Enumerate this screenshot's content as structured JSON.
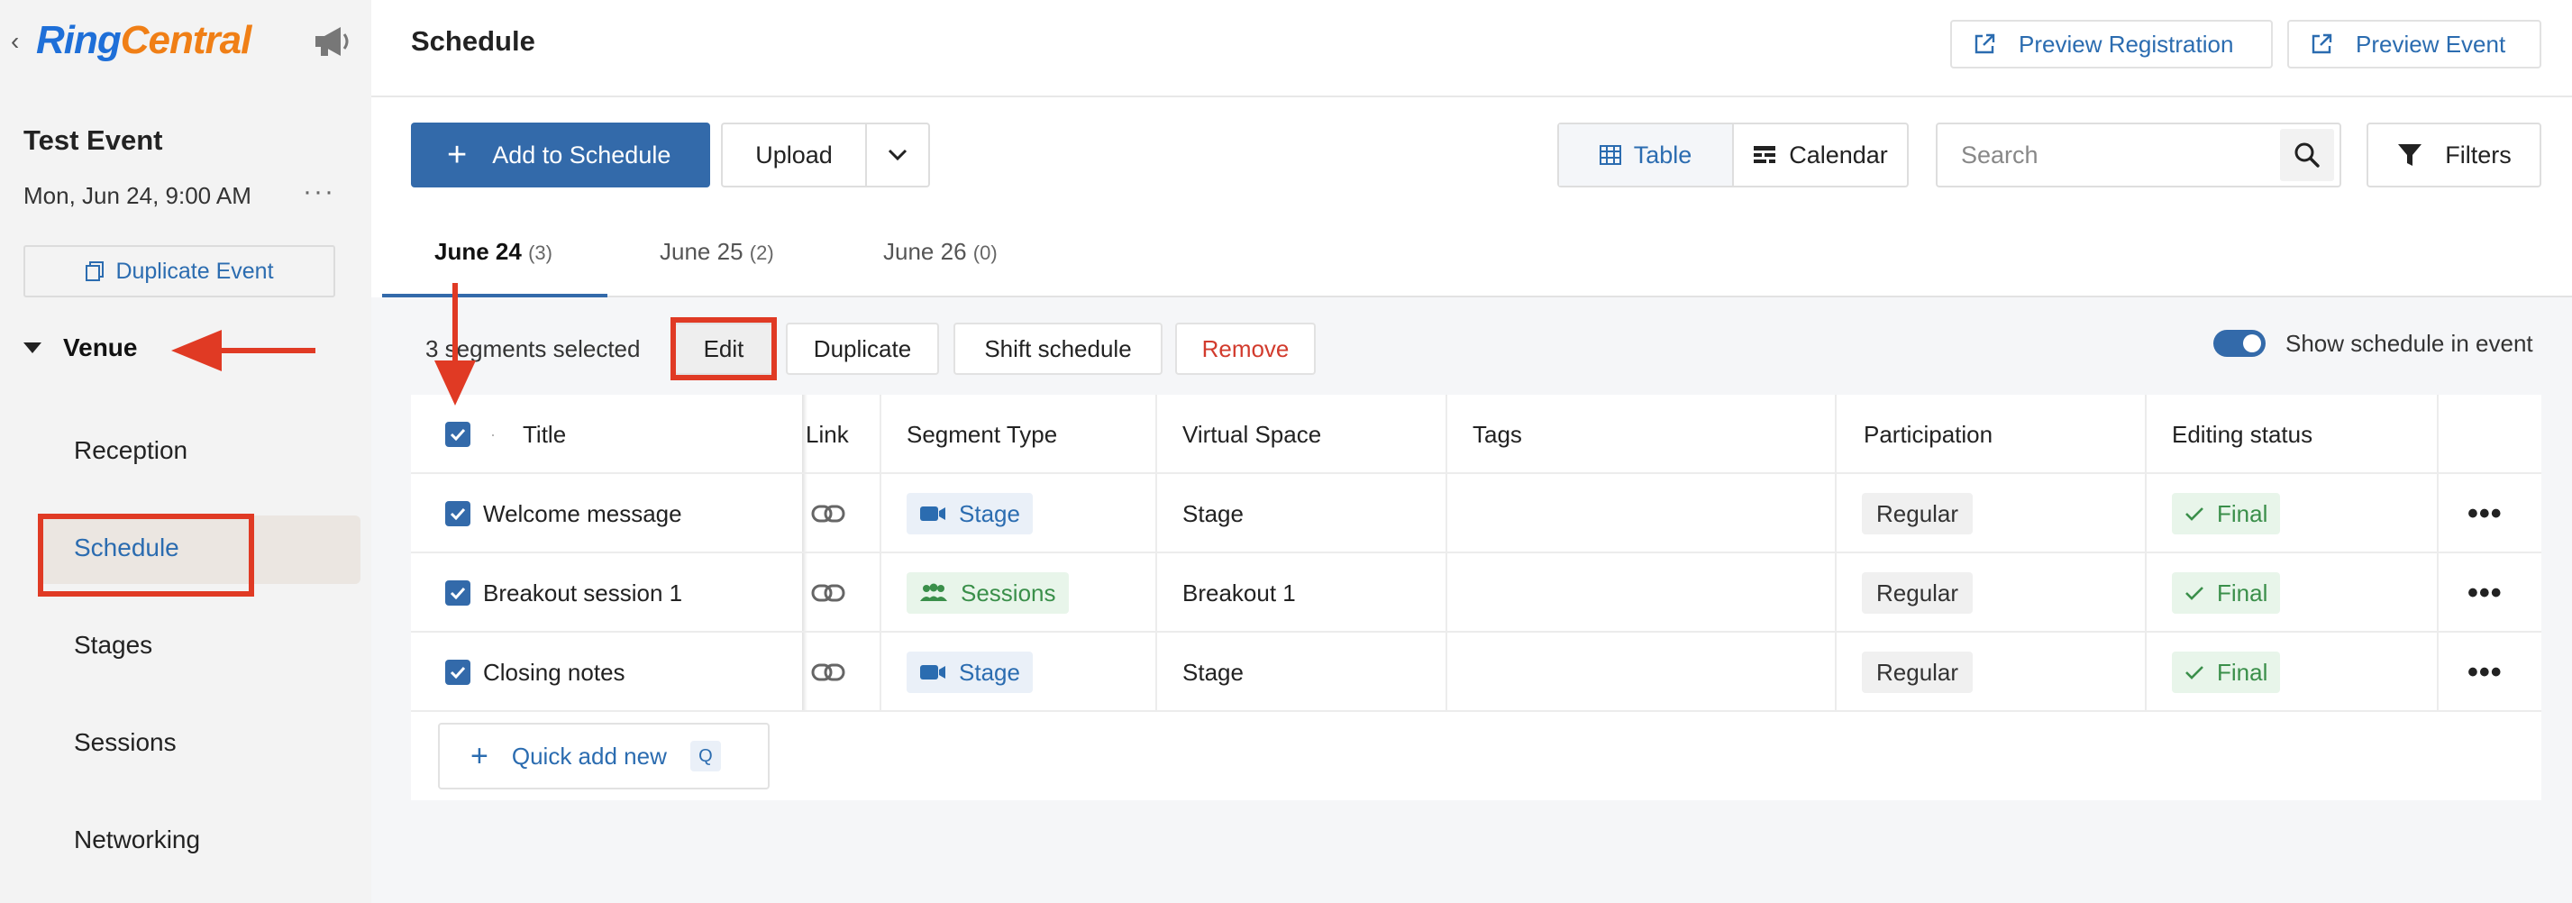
{
  "sidebar": {
    "logo_ring": "Ring",
    "logo_central": "Central",
    "event_title": "Test Event",
    "event_date": "Mon, Jun 24, 9:00 AM",
    "more": "···",
    "duplicate_event": "Duplicate Event",
    "venue_label": "Venue",
    "items": [
      {
        "label": "Reception"
      },
      {
        "label": "Schedule"
      },
      {
        "label": "Stages"
      },
      {
        "label": "Sessions"
      },
      {
        "label": "Networking"
      }
    ],
    "active_item": "Schedule"
  },
  "header": {
    "title": "Schedule",
    "preview_registration": "Preview Registration",
    "preview_event": "Preview Event"
  },
  "toolbar": {
    "add_to_schedule": "Add to Schedule",
    "upload": "Upload",
    "view_table": "Table",
    "view_calendar": "Calendar",
    "active_view": "Table",
    "search_placeholder": "Search",
    "filters": "Filters"
  },
  "tabs": [
    {
      "label": "June 24",
      "count": "(3)",
      "active": true
    },
    {
      "label": "June 25",
      "count": "(2)",
      "active": false
    },
    {
      "label": "June 26",
      "count": "(0)",
      "active": false
    }
  ],
  "selection": {
    "text": "3 segments selected",
    "edit": "Edit",
    "duplicate": "Duplicate",
    "shift": "Shift schedule",
    "remove": "Remove"
  },
  "show_schedule": {
    "label": "Show schedule in event",
    "enabled": true
  },
  "table": {
    "headers": {
      "dot": "·",
      "title": "Title",
      "link": "Link",
      "segment_type": "Segment Type",
      "virtual_space": "Virtual Space",
      "tags": "Tags",
      "participation": "Participation",
      "editing_status": "Editing status"
    },
    "rows": [
      {
        "title": "Welcome message",
        "segment_type": "Stage",
        "segment_icon": "video-camera-icon",
        "virtual_space": "Stage",
        "tags": "",
        "participation": "Regular",
        "status": "Final"
      },
      {
        "title": "Breakout session 1",
        "segment_type": "Sessions",
        "segment_icon": "people-group-icon",
        "virtual_space": "Breakout 1",
        "tags": "",
        "participation": "Regular",
        "status": "Final"
      },
      {
        "title": "Closing notes",
        "segment_type": "Stage",
        "segment_icon": "video-camera-icon",
        "virtual_space": "Stage",
        "tags": "",
        "participation": "Regular",
        "status": "Final"
      }
    ],
    "more": "•••"
  },
  "quick_add": {
    "label": "Quick add new",
    "shortcut": "Q"
  },
  "colors": {
    "primary": "#336aaa",
    "link": "#2b6cb0",
    "annotation": "#e03a24",
    "success": "#3a8f4a",
    "danger": "#d23b2d"
  }
}
